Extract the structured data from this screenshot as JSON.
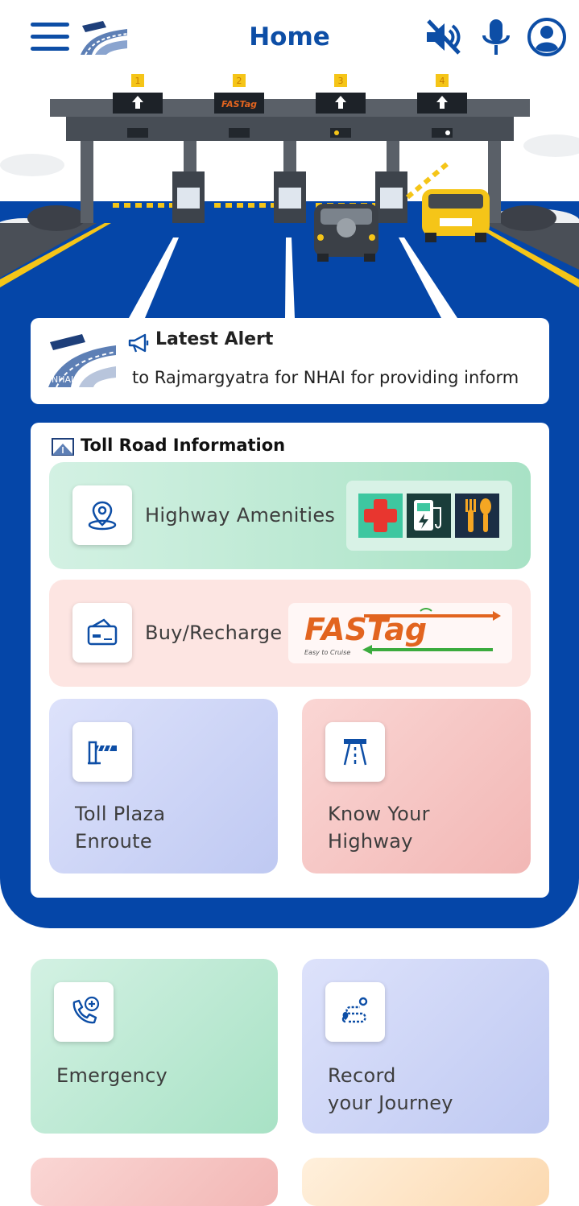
{
  "header": {
    "title": "Home",
    "menu_icon": "hamburger-menu-icon",
    "logo_icon": "nhai-highway-logo-icon",
    "mute_icon": "speaker-muted-icon",
    "mic_icon": "microphone-icon",
    "profile_icon": "user-profile-icon",
    "accent_color": "#0d4ea6"
  },
  "banner": {
    "lanes": [
      "1",
      "2",
      "3",
      "4"
    ],
    "fastag_sign": "FASTag"
  },
  "alert": {
    "title": "Latest Alert",
    "text": "to Rajmargyatra for NHAI for providing inform",
    "logo_text": "NHAI",
    "icon": "megaphone-icon"
  },
  "toll_info": {
    "title": "Toll Road Information",
    "icon": "toll-road-icon",
    "amenities_label": "Highway Amenities",
    "buy_label": "Buy/Recharge",
    "fastag_logo_text": "FASTag",
    "fastag_tagline": "Easy to Cruise",
    "toll_plaza_line1": "Toll Plaza",
    "toll_plaza_line2": "Enroute",
    "know_line1": "Know Your",
    "know_line2": "Highway"
  },
  "shortcuts": {
    "emergency_label": "Emergency",
    "record_line1": "Record",
    "record_line2": "your Journey"
  },
  "colors": {
    "blue_bg": "#0546a8",
    "amenities_tile": "#c4ecd9",
    "buy_tile": "#fde5e2",
    "toll_tile": "#ccd4f5",
    "know_tile": "#f6c7c5"
  }
}
